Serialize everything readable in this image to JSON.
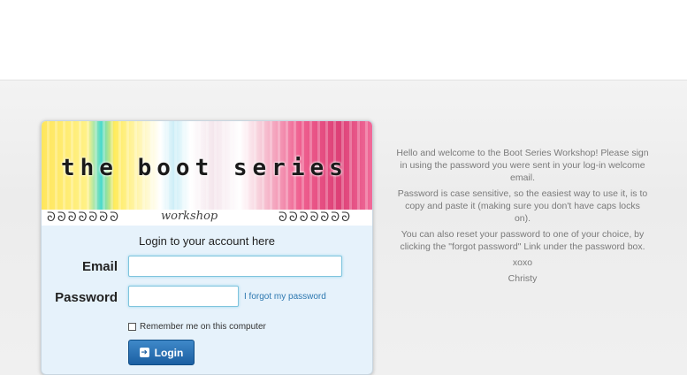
{
  "banner": {
    "title": "the boot series",
    "subtitle": "workshop",
    "curls_left": "ᘐᘐᘐᘐᘐᘐᘐ",
    "curls_right": "ᘐᘐᘐᘐᘐᘐᘐ"
  },
  "login": {
    "heading": "Login to your account here",
    "email_label": "Email",
    "email_value": "",
    "password_label": "Password",
    "password_value": "",
    "forgot_link": "I forgot my password",
    "remember_label": "Remember me on this computer",
    "remember_checked": false,
    "button_label": "Login"
  },
  "info": {
    "paragraphs": [
      "Hello and welcome to the Boot Series Workshop! Please sign in using the password you were sent in your log-in welcome email.",
      "Password is case sensitive, so the easiest way to use it, is to copy and paste it (making sure you don't have caps locks on).",
      "You can also reset your password to one of your choice, by clicking the \"forgot password\" Link under the password box.",
      "xoxo",
      "Christy"
    ]
  },
  "colors": {
    "card_bg": "#e6f2fb",
    "button": "#1b5fa2",
    "link": "#2d78b0"
  }
}
